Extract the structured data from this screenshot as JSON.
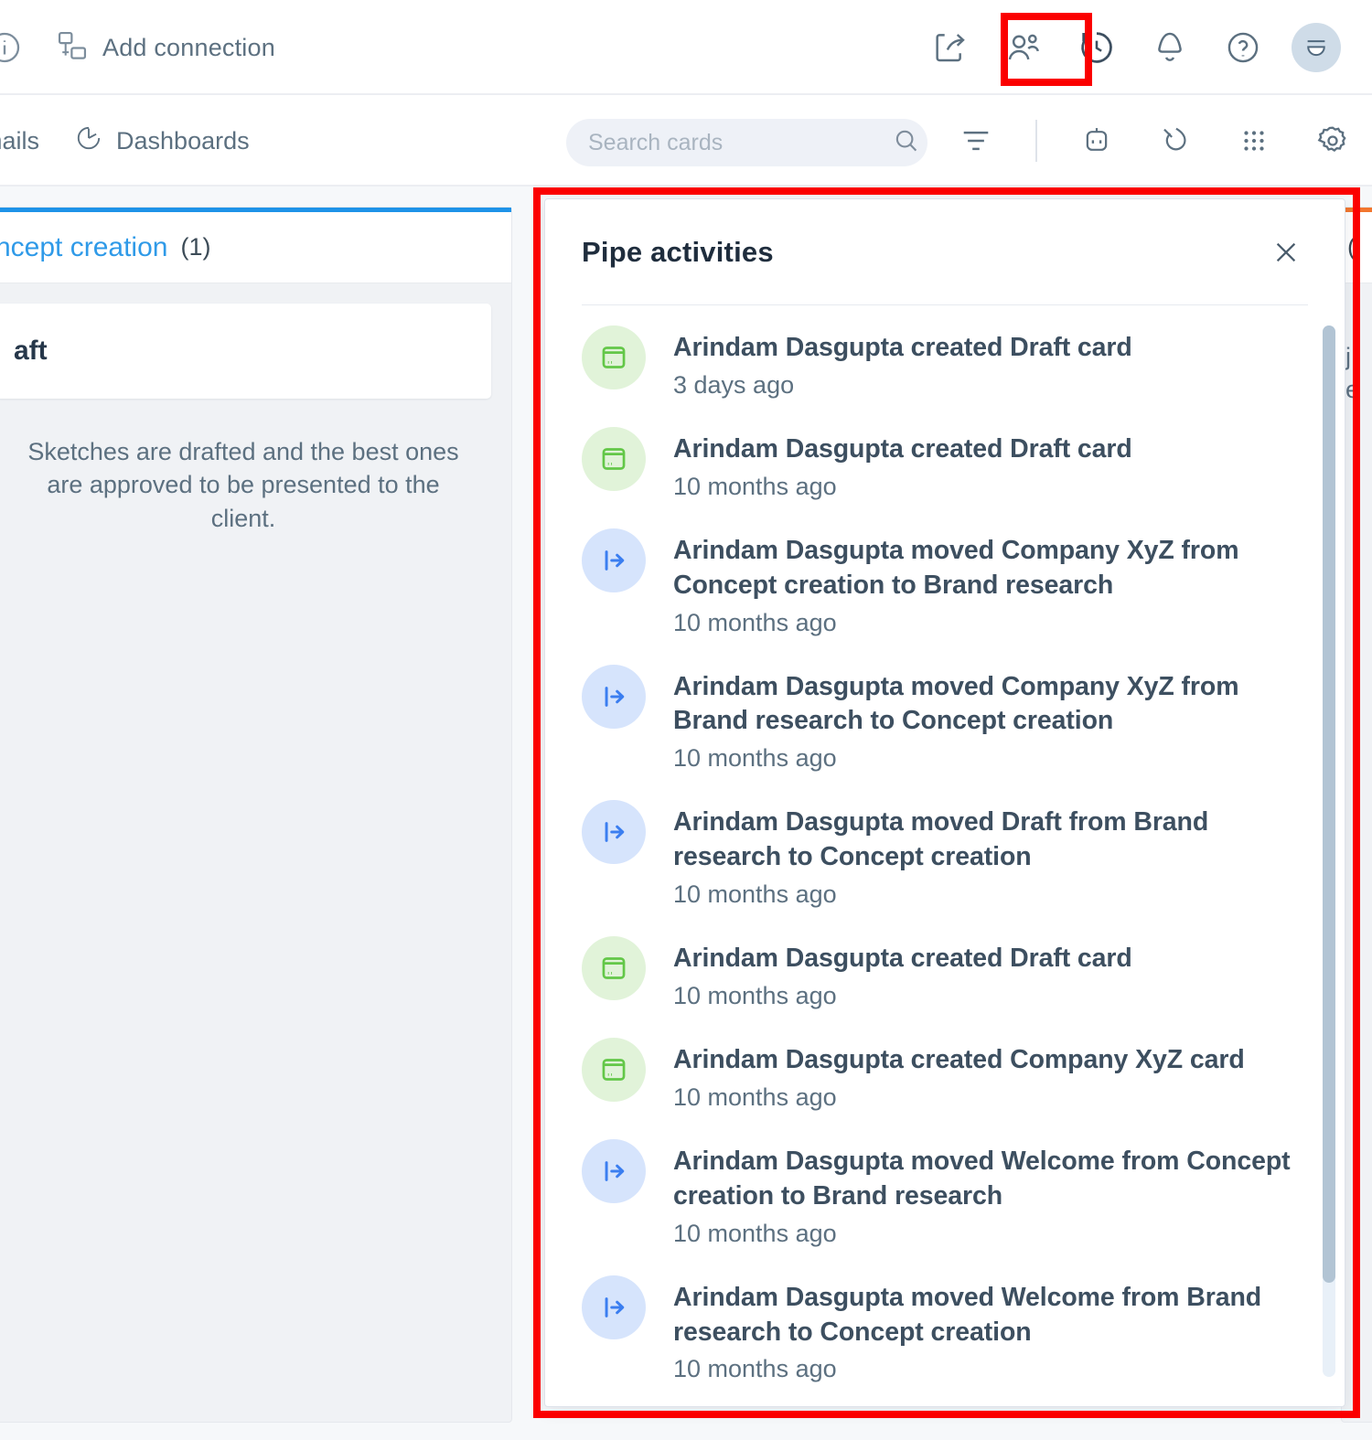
{
  "topbar": {
    "info_icon": "info-circle-icon",
    "add_connection_label": "Add connection",
    "add_connection_icon": "add-connection-icon",
    "right_icons": [
      {
        "name": "share-icon",
        "label": "Share"
      },
      {
        "name": "members-icon",
        "label": "Members"
      },
      {
        "name": "history-icon",
        "label": "Pipe activities"
      },
      {
        "name": "bell-icon",
        "label": "Notifications"
      },
      {
        "name": "help-icon",
        "label": "Help"
      }
    ],
    "avatar_icon": "smiley-avatar-icon"
  },
  "toolbar": {
    "nav_items": [
      {
        "label": "Emails",
        "icon": "mail-icon"
      },
      {
        "label": "Dashboards",
        "icon": "pie-chart-icon"
      }
    ],
    "search": {
      "placeholder": "Search cards",
      "value": "",
      "icon": "search-icon"
    },
    "filter_icon": "filter-icon",
    "action_icons": [
      {
        "name": "automation-robot-icon"
      },
      {
        "name": "database-connection-icon"
      },
      {
        "name": "apps-grid-icon"
      },
      {
        "name": "gear-icon"
      }
    ]
  },
  "board": {
    "column": {
      "title": "Concept creation",
      "title_truncated": "ncept creation",
      "count": "(1)",
      "card_title": "aft",
      "description": "Sketches are drafted and the best ones are approved to be presented to the client.",
      "accent_color": "#1e93e8"
    },
    "column_right": {
      "count": "(",
      "line1": "j",
      "line2": "e",
      "accent_color": "#f2762e"
    }
  },
  "panel": {
    "title": "Pipe activities",
    "close_icon": "close-icon",
    "activities": [
      {
        "icon": "card-created-icon",
        "kind": "green",
        "text": "Arindam Dasgupta created Draft card",
        "time": "3 days ago"
      },
      {
        "icon": "card-created-icon",
        "kind": "green",
        "text": "Arindam Dasgupta created Draft card",
        "time": "10 months ago"
      },
      {
        "icon": "card-moved-icon",
        "kind": "blue",
        "text": "Arindam Dasgupta moved Company XyZ from Concept creation to Brand research",
        "time": "10 months ago"
      },
      {
        "icon": "card-moved-icon",
        "kind": "blue",
        "text": "Arindam Dasgupta moved Company XyZ from Brand research to Concept creation",
        "time": "10 months ago"
      },
      {
        "icon": "card-moved-icon",
        "kind": "blue",
        "text": "Arindam Dasgupta moved Draft from Brand research to Concept creation",
        "time": "10 months ago"
      },
      {
        "icon": "card-created-icon",
        "kind": "green",
        "text": "Arindam Dasgupta created Draft card",
        "time": "10 months ago"
      },
      {
        "icon": "card-created-icon",
        "kind": "green",
        "text": "Arindam Dasgupta created Company XyZ card",
        "time": "10 months ago"
      },
      {
        "icon": "card-moved-icon",
        "kind": "blue",
        "text": "Arindam Dasgupta moved Welcome from Concept creation to Brand research",
        "time": "10 months ago"
      },
      {
        "icon": "card-moved-icon",
        "kind": "blue",
        "text": "Arindam Dasgupta moved Welcome from Brand research to Concept creation",
        "time": "10 months ago"
      }
    ]
  },
  "highlights": {
    "color": "#fb0000",
    "targets": [
      "history-icon",
      "pipe-activities-panel"
    ]
  }
}
